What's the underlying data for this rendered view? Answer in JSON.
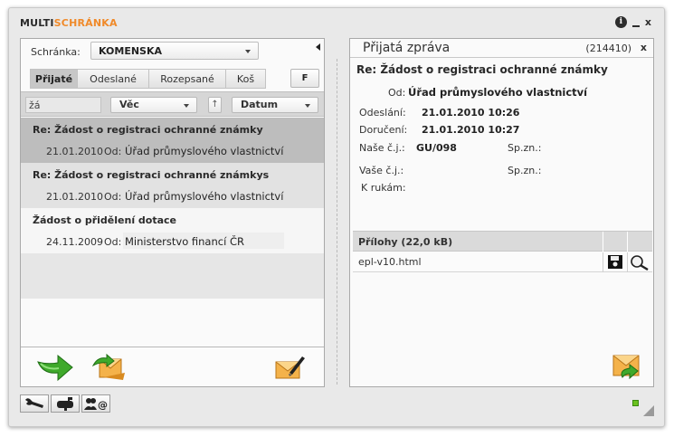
{
  "app": {
    "title_part1": "MULTI",
    "title_part2": "SCHRÁNKA"
  },
  "colors": {
    "brand_orange": "#f08a2a",
    "selected_row": "#bdbdbd",
    "status_green": "#6ac11f"
  },
  "left": {
    "mailbox_label": "Schránka:",
    "mailbox_value": "KOMENSKA",
    "tabs": [
      {
        "label": "Přijaté",
        "active": true
      },
      {
        "label": "Odeslané",
        "active": false
      },
      {
        "label": "Rozepsané",
        "active": false
      },
      {
        "label": "Koš",
        "active": false
      }
    ],
    "filter_button": "F",
    "filter_value": "žá",
    "sort_field_1": "Věc",
    "sort_direction": "↑",
    "sort_field_2": "Datum",
    "from_label": "Od:",
    "messages": [
      {
        "subject": "Re: Žádost o registraci ochranné známky",
        "date": "21.01.2010",
        "from": "Úřad průmyslového vlastnictví",
        "state": "selected"
      },
      {
        "subject": "Re: Žádost o registraci ochranné známkys",
        "date": "21.01.2010",
        "from": "Úřad průmyslového vlastnictví",
        "state": "alt"
      },
      {
        "subject": "Žádost o přidělení dotace",
        "date": "24.11.2009",
        "from": "Ministerstvo financí ČR",
        "state": "plain"
      }
    ],
    "icons": [
      "forward-arrow-icon",
      "open-envelope-icon",
      "new-message-icon"
    ]
  },
  "right": {
    "title": "Přijatá zpráva",
    "message_id": "(214410)",
    "close": "x",
    "subject": "Re: Žádost o registraci ochranné známky",
    "fields": {
      "from_label": "Od:",
      "from_value": "Úřad průmyslového vlastnictví",
      "sent_label": "Odeslání:",
      "sent_value": "21.01.2010 10:26",
      "delivered_label": "Doručení:",
      "delivered_value": "21.01.2010 10:27",
      "our_ref_label": "Naše č.j.:",
      "our_ref_value": "GU/098",
      "our_spzn_label": "Sp.zn.:",
      "your_ref_label": "Vaše č.j.:",
      "your_spzn_label": "Sp.zn.:",
      "attention_label": "K rukám:"
    },
    "attachments_header": "Přílohy (22,0 kB)",
    "attachments": [
      {
        "name": "epl-v10.html"
      }
    ]
  },
  "bottom_toolbar": [
    "wrench-icon",
    "mailbox-icon",
    "contacts-icon"
  ]
}
